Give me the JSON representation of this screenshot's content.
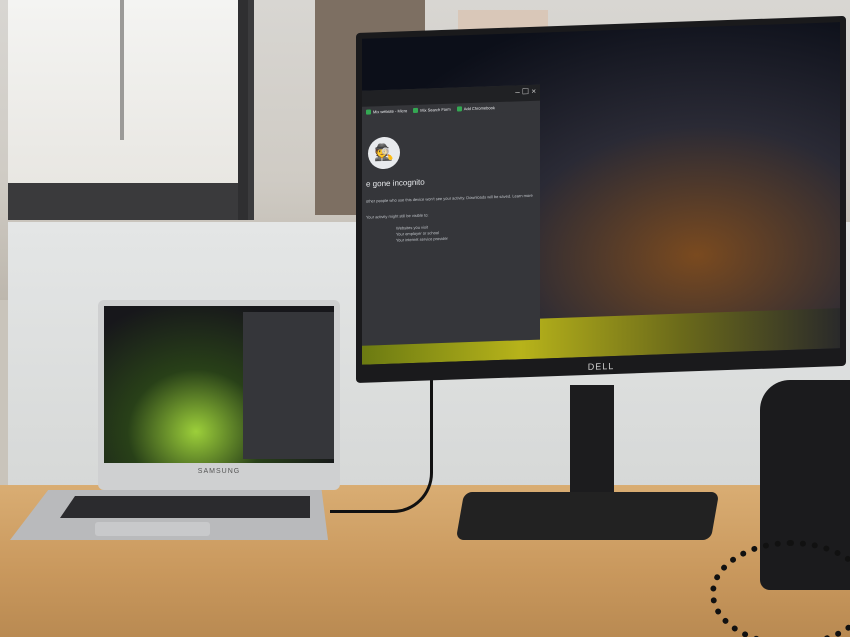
{
  "monitor": {
    "brand": "DELL",
    "browser": {
      "window_controls": "– ☐ ×",
      "bookmarks": [
        {
          "label": "Mix website - Micro"
        },
        {
          "label": "Mix Search Form"
        },
        {
          "label": "Add Chromebook"
        }
      ],
      "headline": "e gone incognito",
      "intro": "other people who use this device won't see your activity. Downloads will be saved. Learn more",
      "visible_to": "Your activity might still be visible to:",
      "visible_list": [
        "Websites you visit",
        "Your employer or school",
        "Your internet service provider"
      ]
    }
  },
  "laptop": {
    "brand": "SAMSUNG"
  }
}
